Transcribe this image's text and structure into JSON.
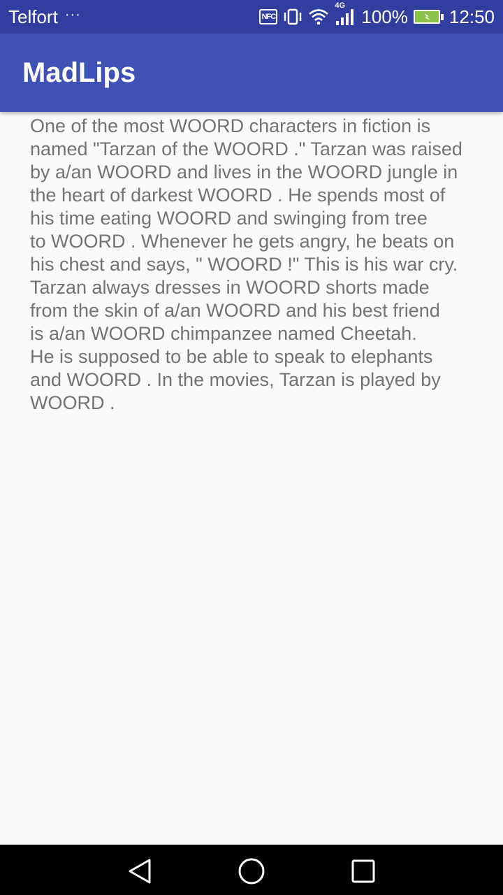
{
  "status_bar": {
    "carrier": "Telfort",
    "more_indicator": "···",
    "nfc_label": "NFC",
    "network_type": "4G",
    "battery_percent": "100%",
    "time": "12:50",
    "icons": [
      "nfc-icon",
      "vibrate-icon",
      "wifi-icon",
      "signal-icon",
      "battery-icon"
    ],
    "battery_level": 1.0
  },
  "app_bar": {
    "title": "MadLips"
  },
  "story": {
    "text": "One of the most WOORD characters in fiction is\nnamed \"Tarzan of the WOORD .\" Tarzan was raised\nby a/an WOORD and lives in the WOORD jungle in\nthe heart of darkest WOORD . He spends most of\nhis time eating WOORD and swinging from tree\nto WOORD . Whenever he gets angry, he beats on\nhis chest and says, \" WOORD !\" This is his war cry.\nTarzan always dresses in WOORD shorts made\nfrom the skin of a/an WOORD and his best friend\nis a/an WOORD chimpanzee named Cheetah.\nHe is supposed to be able to speak to elephants\nand WOORD . In the movies, Tarzan is played by\nWOORD ."
  },
  "nav_bar": {
    "icons": [
      "back-icon",
      "home-icon",
      "recents-icon"
    ]
  },
  "colors": {
    "status_bar": "#303f9f",
    "app_bar": "#3f51b5",
    "background": "#fafafa",
    "text": "#737373",
    "nav_bar": "#000000"
  }
}
